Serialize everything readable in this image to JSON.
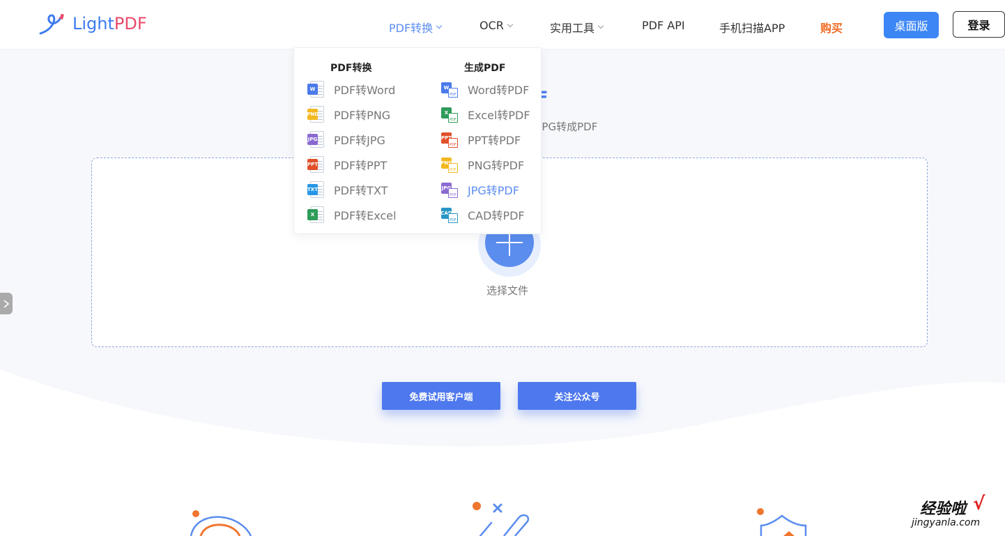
{
  "header": {
    "logo_light": "Light",
    "logo_pdf": "PDF",
    "nav": [
      {
        "label": "PDF转换",
        "dropdown": true,
        "active": true
      },
      {
        "label": "OCR",
        "dropdown": true
      },
      {
        "label": "实用工具",
        "dropdown": true
      },
      {
        "label": "PDF API"
      },
      {
        "label": "手机扫描APP"
      },
      {
        "label": "购买",
        "highlight": true
      }
    ],
    "desktop_button": "桌面版",
    "login_button": "登录"
  },
  "dropdown": {
    "left_heading": "PDF转换",
    "right_heading": "生成PDF",
    "left_items": [
      {
        "label": "PDF转Word",
        "icon": "word-icon",
        "badge": "W",
        "color": "#4b7bea"
      },
      {
        "label": "PDF转PNG",
        "icon": "png-icon",
        "badge": "PNG",
        "color": "#f3b81f"
      },
      {
        "label": "PDF转JPG",
        "icon": "jpg-icon",
        "badge": "JPG",
        "color": "#8a6ad0"
      },
      {
        "label": "PDF转PPT",
        "icon": "ppt-icon",
        "badge": "PPT",
        "color": "#e0502a"
      },
      {
        "label": "PDF转TXT",
        "icon": "txt-icon",
        "badge": "TXT",
        "color": "#2896e6"
      },
      {
        "label": "PDF转Excel",
        "icon": "excel-icon",
        "badge": "X",
        "color": "#2f9c5a"
      }
    ],
    "right_items": [
      {
        "label": "Word转PDF",
        "icon": "word-to-pdf-icon",
        "badge": "W",
        "color": "#4b7bea"
      },
      {
        "label": "Excel转PDF",
        "icon": "excel-to-pdf-icon",
        "badge": "X",
        "color": "#2f9c5a"
      },
      {
        "label": "PPT转PDF",
        "icon": "ppt-to-pdf-icon",
        "badge": "PPT",
        "color": "#e0502a"
      },
      {
        "label": "PNG转PDF",
        "icon": "png-to-pdf-icon",
        "badge": "PNG",
        "color": "#f3b81f"
      },
      {
        "label": "JPG转PDF",
        "icon": "jpg-to-pdf-icon",
        "badge": "JPG",
        "color": "#8a6ad0",
        "highlight": true
      },
      {
        "label": "CAD转PDF",
        "icon": "cad-to-pdf-icon",
        "badge": "CAD",
        "color": "#2896c6"
      }
    ]
  },
  "hero": {
    "title_visible": "F",
    "subtitle_visible": "JPG转成PDF"
  },
  "upload": {
    "select_label": "选择文件"
  },
  "cta": {
    "trial_button": "免费试用客户端",
    "follow_button": "关注公众号"
  },
  "watermark": {
    "text_cn": "经验啦",
    "url": "jingyanla.com"
  },
  "colors": {
    "primary": "#5b8def",
    "button_blue": "#3d86f5",
    "cta_blue": "#4e78ee",
    "buy_orange": "#f16a23",
    "logo_red": "#e94a6a"
  }
}
